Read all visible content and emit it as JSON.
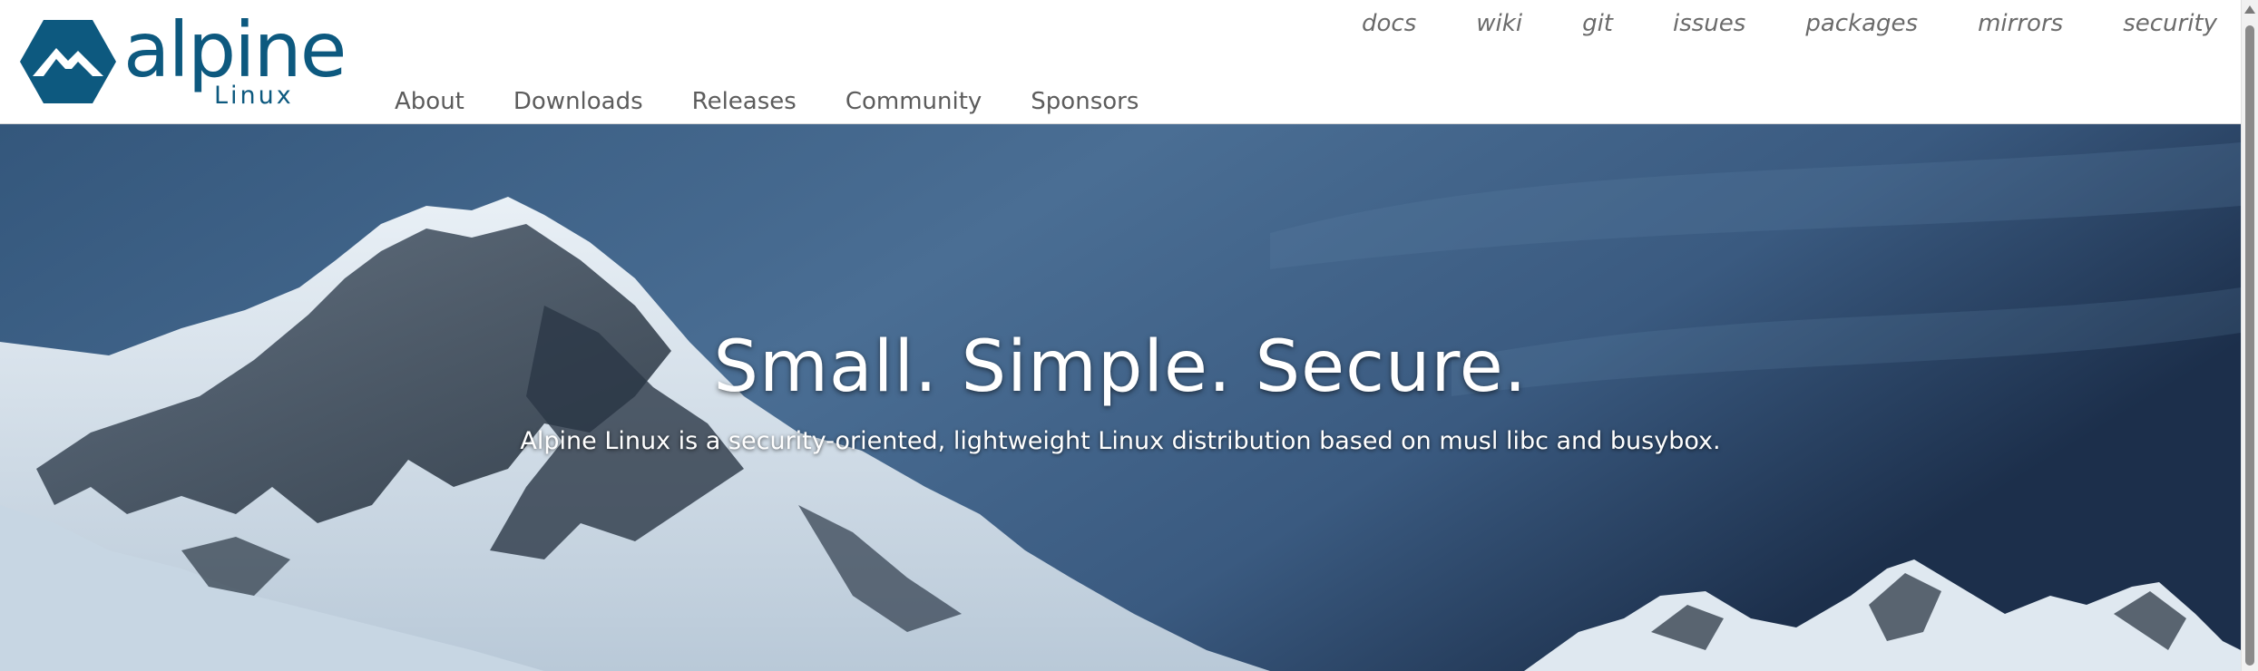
{
  "header": {
    "logo": {
      "wordmark_main": "alpine",
      "wordmark_sub": "Linux",
      "icon": "mountain-hexagon-icon",
      "brand_color": "#0d597f"
    },
    "main_nav": [
      {
        "label": "About"
      },
      {
        "label": "Downloads"
      },
      {
        "label": "Releases"
      },
      {
        "label": "Community"
      },
      {
        "label": "Sponsors"
      }
    ],
    "top_nav": [
      {
        "label": "docs"
      },
      {
        "label": "wiki"
      },
      {
        "label": "git"
      },
      {
        "label": "issues"
      },
      {
        "label": "packages"
      },
      {
        "label": "mirrors"
      },
      {
        "label": "security"
      }
    ]
  },
  "hero": {
    "title": "Small. Simple. Secure.",
    "subtitle": "Alpine Linux is a security-oriented, lightweight Linux distribution based on musl libc and busybox.",
    "background": "snowy-mountain-peaks-photo"
  },
  "colors": {
    "nav_text": "#5c5c5c",
    "top_nav_text": "#6b6b6b",
    "hero_sky": "#3f6184"
  }
}
